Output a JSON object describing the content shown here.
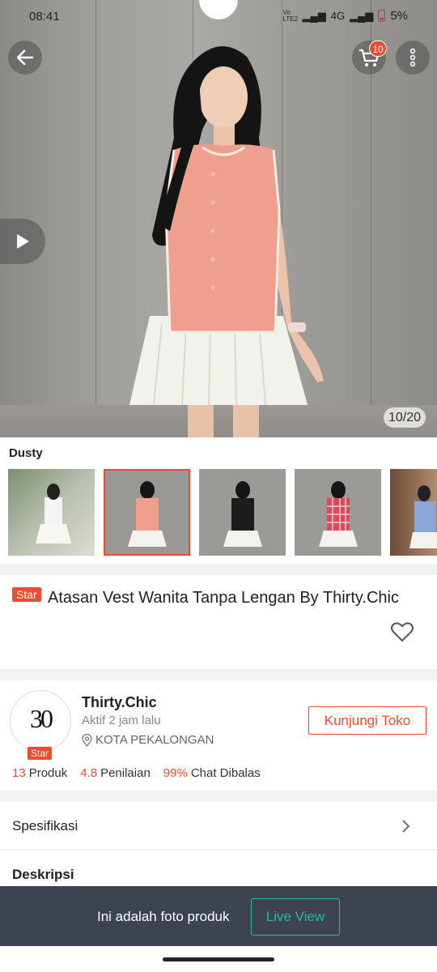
{
  "status_bar": {
    "time": "08:41",
    "signal": "Vo LTE2",
    "network": "4G",
    "battery": "5%"
  },
  "header": {
    "cart_count": "10",
    "icons": {
      "back": "arrow-left-icon",
      "cart": "cart-icon",
      "more": "more-vertical-icon",
      "play": "play-icon"
    }
  },
  "gallery": {
    "counter": "10/20"
  },
  "variants": {
    "label": "Dusty",
    "items": [
      {
        "name": "white-top",
        "selected": false
      },
      {
        "name": "dusty",
        "selected": true
      },
      {
        "name": "black",
        "selected": false
      },
      {
        "name": "red-plaid",
        "selected": false
      },
      {
        "name": "blue",
        "selected": false
      }
    ]
  },
  "product": {
    "badge": "Star",
    "title": "Atasan Vest Wanita Tanpa Lengan By Thirty.Chic"
  },
  "shop": {
    "logo_text": "30",
    "badge": "Star",
    "name": "Thirty.Chic",
    "active": "Aktif 2 jam lalu",
    "location": "KOTA PEKALONGAN",
    "visit_button": "Kunjungi Toko",
    "stats": [
      {
        "value": "13",
        "label": "Produk"
      },
      {
        "value": "4.8",
        "label": "Penilaian"
      },
      {
        "value": "99%",
        "label": "Chat Dibalas"
      }
    ]
  },
  "sections": {
    "spec": "Spesifikasi",
    "desc": "Deskripsi"
  },
  "banner": {
    "message": "Ini adalah foto produk",
    "button": "Live View"
  },
  "colors": {
    "accent": "#ee4d2d",
    "live": "#2bb6a6",
    "banner_bg": "#3e4352"
  }
}
